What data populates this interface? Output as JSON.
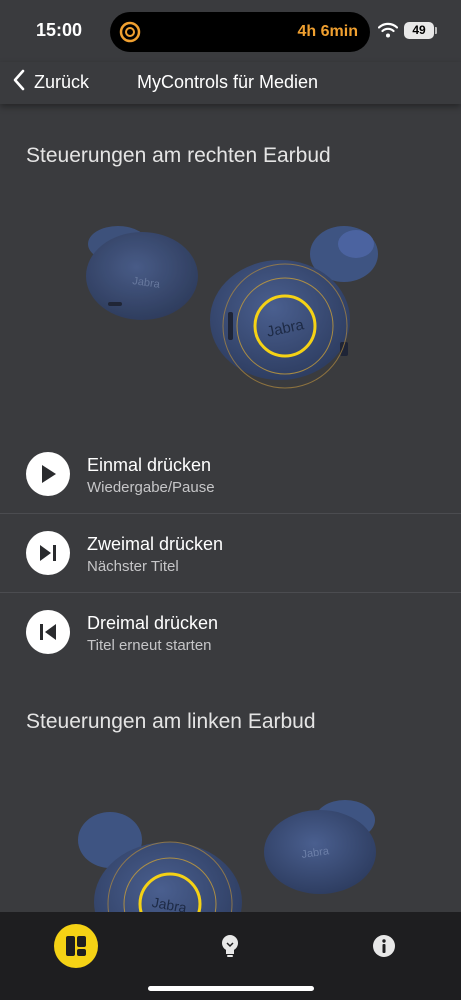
{
  "status_bar": {
    "time": "15:00",
    "activity_text": "4h 6min",
    "battery_level": "49",
    "icons": [
      "timer-icon",
      "wifi-icon",
      "battery-icon"
    ]
  },
  "nav": {
    "back_label": "Zurück",
    "title": "MyControls für Medien"
  },
  "right_section": {
    "heading": "Steuerungen am rechten Earbud",
    "earbud_brand": "Jabra",
    "controls": [
      {
        "title": "Einmal drücken",
        "subtitle": "Wiedergabe/Pause",
        "icon": "play-icon"
      },
      {
        "title": "Zweimal drücken",
        "subtitle": "Nächster Titel",
        "icon": "next-track-icon"
      },
      {
        "title": "Dreimal drücken",
        "subtitle": "Titel erneut starten",
        "icon": "previous-track-icon"
      }
    ]
  },
  "left_section": {
    "heading": "Steuerungen am linken Earbud",
    "earbud_brand": "Jabra"
  },
  "tab_bar": {
    "tabs": [
      {
        "name": "controls",
        "icon": "controls-icon",
        "active": true
      },
      {
        "name": "tips",
        "icon": "lightbulb-icon",
        "active": false
      },
      {
        "name": "info",
        "icon": "info-icon",
        "active": false
      }
    ]
  },
  "colors": {
    "background": "#3a3b3e",
    "accent_yellow": "#f5d215",
    "activity_orange": "#f0a030",
    "earbud_blue": "#3b4f7a",
    "tab_bar": "#1e1e20"
  }
}
